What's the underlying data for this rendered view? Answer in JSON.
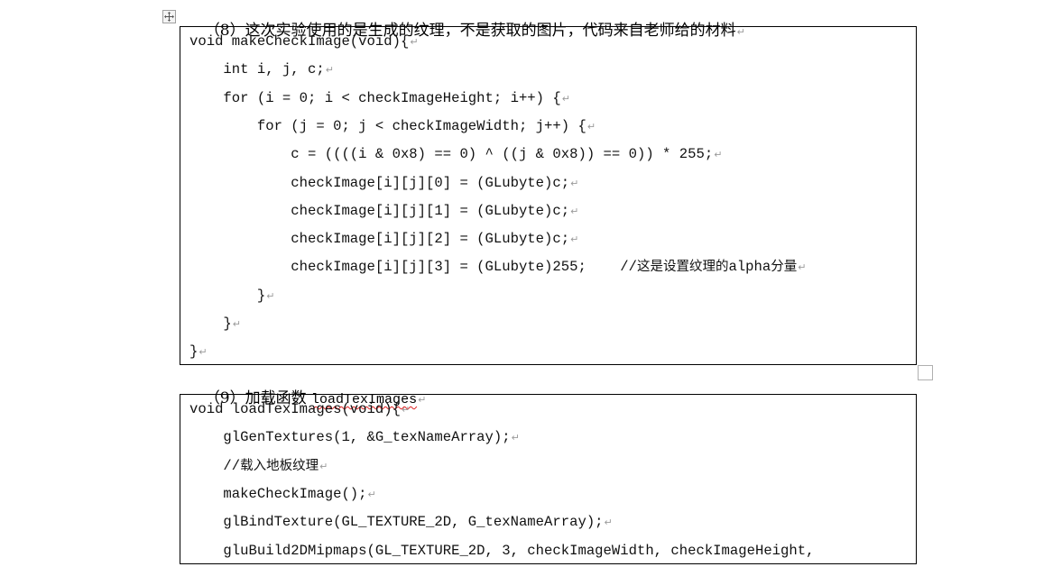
{
  "section8": {
    "heading": "（8）这次实验使用的是生成的纹理，不是获取的图片，代码来自老师给的材料",
    "code_lines": [
      "void makeCheckImage(void){",
      "    int i, j, c;",
      "    for (i = 0; i < checkImageHeight; i++) {",
      "        for (j = 0; j < checkImageWidth; j++) {",
      "            c = ((((i & 0x8) == 0) ^ ((j & 0x8)) == 0)) * 255;",
      "            checkImage[i][j][0] = (GLubyte)c;",
      "            checkImage[i][j][1] = (GLubyte)c;",
      "            checkImage[i][j][2] = (GLubyte)c;",
      "            checkImage[i][j][3] = (GLubyte)255;    //这是设置纹理的alpha分量",
      "        }",
      "    }",
      "}"
    ]
  },
  "section9": {
    "heading_prefix": "（9）加载函数 ",
    "heading_code": "loadTexImages",
    "code_lines": [
      "void loadTexImages(void){",
      "    glGenTextures(1, &G_texNameArray);",
      "    //载入地板纹理",
      "    makeCheckImage();",
      "    glBindTexture(GL_TEXTURE_2D, G_texNameArray);",
      "    gluBuild2DMipmaps(GL_TEXTURE_2D, 3, checkImageWidth, checkImageHeight,"
    ]
  },
  "paragraph_mark": "↵",
  "icons": {
    "table_move_handle": "move-arrows",
    "table_resize_handle": "square"
  }
}
